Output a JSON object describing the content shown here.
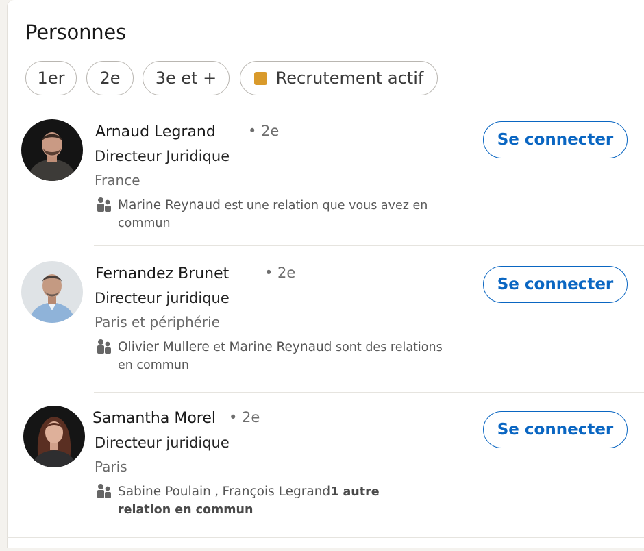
{
  "section": {
    "title": "Personnes"
  },
  "filters": [
    {
      "label": "1er"
    },
    {
      "label": "2e"
    },
    {
      "label": "3e et +"
    },
    {
      "label": "Recrutement actif",
      "swatch_color": "#d99a2b"
    }
  ],
  "people": [
    {
      "name": "Arnaud Legrand",
      "degree": "• 2e",
      "headline": "Directeur Juridique",
      "location": "France",
      "mutual": {
        "p1": "Marine Reynaud",
        "t1": " est une relation que vous avez en commun"
      },
      "connect_label": "Se connecter"
    },
    {
      "name": "Fernandez Brunet",
      "degree": "• 2e",
      "headline": "Directeur juridique",
      "location": "Paris et périphérie",
      "mutual": {
        "p1": "Olivier Mullere",
        "t1": "  et ",
        "p2": "Marine Reynaud",
        "t2": " sont des relations en commun"
      },
      "connect_label": "Se connecter"
    },
    {
      "name": "Samantha Morel",
      "degree": "• 2e",
      "headline": "Directeur juridique",
      "location": "Paris",
      "mutual": {
        "p1": "Sabine Poulain",
        "t1": "      , ",
        "p2": "François Legrand",
        "t2": "1 autre relation en commun"
      },
      "connect_label": "Se connecter"
    }
  ],
  "colors": {
    "accent": "#0a66c2",
    "background": "#f4f2ee",
    "card": "#ffffff"
  }
}
